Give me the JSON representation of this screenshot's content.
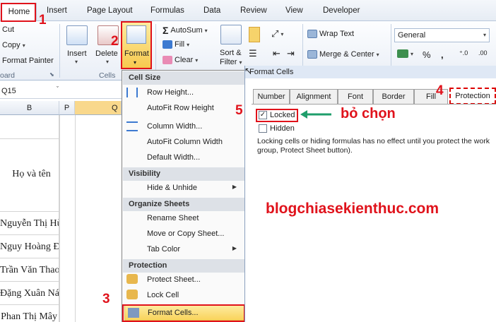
{
  "tabs": [
    "Home",
    "Insert",
    "Page Layout",
    "Formulas",
    "Data",
    "Review",
    "View",
    "Developer"
  ],
  "ribbon": {
    "cut": "Cut",
    "copy": "Copy",
    "format_painter": "Format Painter",
    "clipboard_label": "oard",
    "insert": "Insert",
    "delete": "Delete",
    "format": "Format",
    "cells_label": "Cells",
    "autosum": "AutoSum",
    "fill": "Fill",
    "clear": "Clear",
    "sort_filter_1": "Sort &",
    "sort_filter_2": "Filter",
    "wrap_text": "Wrap Text",
    "merge_center": "Merge & Center",
    "number_format": "General",
    "percent": "%",
    "comma": ","
  },
  "namebox": "Q15",
  "columns": [
    "B",
    "P",
    "Q"
  ],
  "cells": [
    {
      "text": "Họ và tên"
    },
    {
      "text": "Nguyễn Thị Hù"
    },
    {
      "text": "Nguy Hoàng Đ"
    },
    {
      "text": "Trần Văn Thao"
    },
    {
      "text": "Đặng Xuân Nác"
    },
    {
      "text": "Phan Thị Mây"
    }
  ],
  "menu": {
    "cell_size": "Cell Size",
    "row_height": "Row Height...",
    "autofit_row": "AutoFit Row Height",
    "column_width": "Column Width...",
    "autofit_column": "AutoFit Column Width",
    "default_width": "Default Width...",
    "visibility": "Visibility",
    "hide_unhide": "Hide & Unhide",
    "organize": "Organize Sheets",
    "rename": "Rename Sheet",
    "move_copy": "Move or Copy Sheet...",
    "tab_color": "Tab Color",
    "protection": "Protection",
    "protect_sheet": "Protect Sheet...",
    "lock_cell": "Lock Cell",
    "format_cells": "Format Cells..."
  },
  "dialog": {
    "title": "Format Cells",
    "tabs": [
      "Number",
      "Alignment",
      "Font",
      "Border",
      "Fill",
      "Protection"
    ],
    "locked": "Locked",
    "hidden": "Hidden",
    "note_line1": "Locking cells or hiding formulas has no effect until you protect the work",
    "note_line2": "group, Protect Sheet button)."
  },
  "annotations": {
    "step1": "1",
    "step2": "2",
    "step3": "3",
    "step4": "4",
    "step5": "5",
    "uncheck_label": "bỏ chọn",
    "watermark": "blogchiasekienthuc.com"
  },
  "colors": {
    "annotation_red": "#e0121b",
    "arrow_green": "#1f9e6b",
    "highlight": "#f9d35b"
  }
}
